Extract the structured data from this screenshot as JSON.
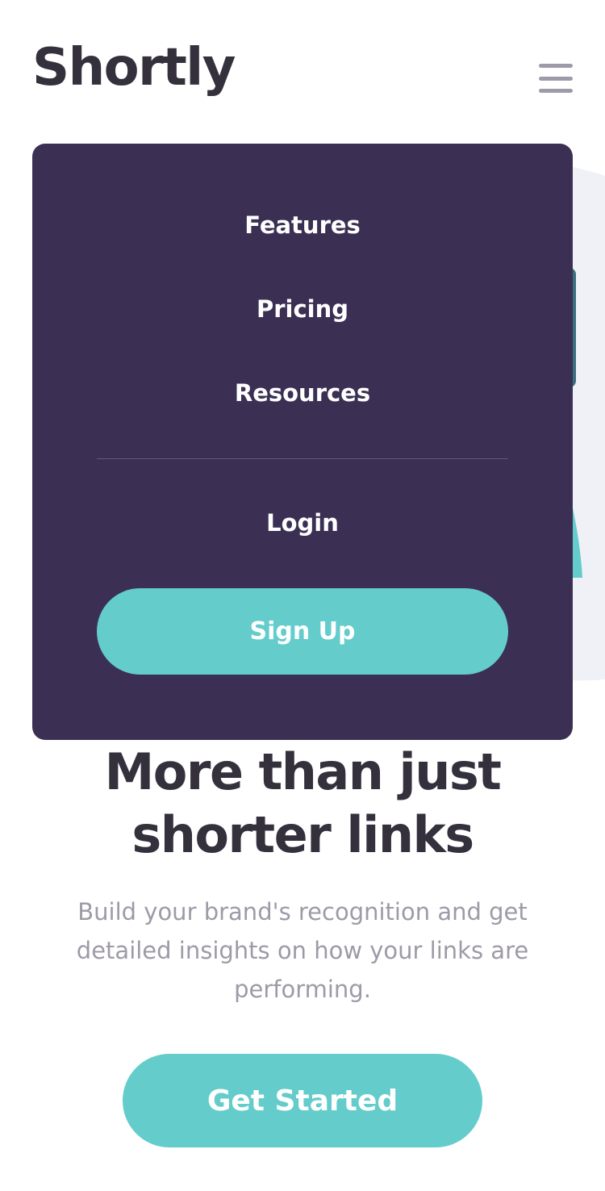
{
  "header": {
    "logo": "Shortly"
  },
  "menu": {
    "links": [
      "Features",
      "Pricing",
      "Resources"
    ],
    "login_label": "Login",
    "signup_label": "Sign Up"
  },
  "hero": {
    "headline_line1": "More than just",
    "headline_line2": "shorter links",
    "subtext": "Build your brand's recognition and get detailed insights on how your links are performing.",
    "cta_label": "Get Started"
  },
  "colors": {
    "primary_cyan": "#64cccb",
    "menu_violet": "#3b3054",
    "heading_dark": "#34313d",
    "muted_gray": "#9e9aa7"
  }
}
